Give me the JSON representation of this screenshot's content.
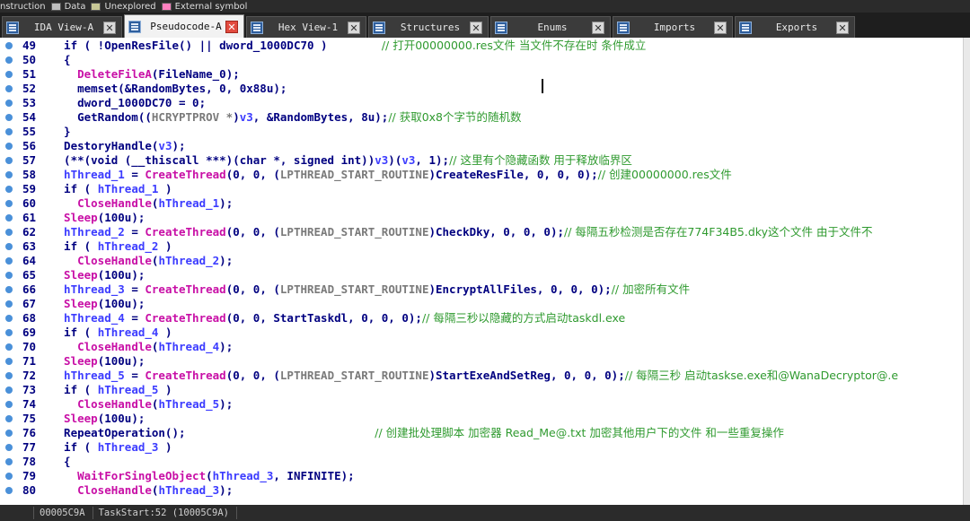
{
  "legend": [
    {
      "label": "nstruction",
      "color": ""
    },
    {
      "label": "Data",
      "color": "#c0c0c0"
    },
    {
      "label": "Unexplored",
      "color": "#c8c896"
    },
    {
      "label": "External symbol",
      "color": "#ff80c0"
    }
  ],
  "tabs": [
    {
      "label": "IDA View-A",
      "active": false,
      "icon": "ida-view-icon"
    },
    {
      "label": "Pseudocode-A",
      "active": true,
      "icon": "pseudocode-icon"
    },
    {
      "label": "Hex View-1",
      "active": false,
      "icon": "hex-view-icon"
    },
    {
      "label": "Structures",
      "active": false,
      "icon": "structures-icon"
    },
    {
      "label": "Enums",
      "active": false,
      "icon": "enums-icon"
    },
    {
      "label": "Imports",
      "active": false,
      "icon": "imports-icon"
    },
    {
      "label": "Exports",
      "active": false,
      "icon": "exports-icon"
    }
  ],
  "code_lines": [
    {
      "num": "49",
      "parts": [
        [
          "k",
          "  if ( !"
        ],
        [
          "fn2",
          "OpenResFile"
        ],
        [
          "k",
          "() || dword_1000DC70 )"
        ],
        [
          "sp",
          "        "
        ],
        [
          "cm",
          "// 打开00000000.res文件 当文件不存在时 条件成立"
        ]
      ]
    },
    {
      "num": "50",
      "parts": [
        [
          "k",
          "  {"
        ]
      ]
    },
    {
      "num": "51",
      "parts": [
        [
          "k",
          "    "
        ],
        [
          "fn",
          "DeleteFileA"
        ],
        [
          "k",
          "(FileName_0);"
        ]
      ]
    },
    {
      "num": "52",
      "parts": [
        [
          "k",
          "    memset(&RandomBytes, 0, 0x88u);"
        ]
      ]
    },
    {
      "num": "53",
      "parts": [
        [
          "k",
          "    dword_1000DC70 = 0;"
        ]
      ]
    },
    {
      "num": "54",
      "parts": [
        [
          "k",
          "    GetRandom(("
        ],
        [
          "cast",
          "HCRYPTPROV *"
        ],
        [
          "k",
          ")"
        ],
        [
          "lv",
          "v3"
        ],
        [
          "k",
          ", &RandomBytes, 8u);"
        ],
        [
          "cm",
          "// 获取0x8个字节的随机数"
        ]
      ]
    },
    {
      "num": "55",
      "parts": [
        [
          "k",
          "  }"
        ]
      ]
    },
    {
      "num": "56",
      "parts": [
        [
          "k",
          "  DestoryHandle("
        ],
        [
          "lv",
          "v3"
        ],
        [
          "k",
          ");"
        ]
      ]
    },
    {
      "num": "57",
      "parts": [
        [
          "k",
          "  (**(void (__thiscall ***)(char *, signed int))"
        ],
        [
          "lv",
          "v3"
        ],
        [
          "k",
          ")("
        ],
        [
          "lv",
          "v3"
        ],
        [
          "k",
          ", 1);"
        ],
        [
          "cm",
          "// 这里有个隐藏函数 用于释放临界区"
        ]
      ]
    },
    {
      "num": "58",
      "parts": [
        [
          "lv",
          "  hThread_1"
        ],
        [
          "k",
          " = "
        ],
        [
          "fn",
          "CreateThread"
        ],
        [
          "k",
          "(0, 0, ("
        ],
        [
          "cast",
          "LPTHREAD_START_ROUTINE"
        ],
        [
          "k",
          ")CreateResFile, 0, 0, 0);"
        ],
        [
          "cm",
          "// 创建00000000.res文件"
        ]
      ]
    },
    {
      "num": "59",
      "parts": [
        [
          "k",
          "  if ( "
        ],
        [
          "lv",
          "hThread_1"
        ],
        [
          "k",
          " )"
        ]
      ]
    },
    {
      "num": "60",
      "parts": [
        [
          "k",
          "    "
        ],
        [
          "fn",
          "CloseHandle"
        ],
        [
          "k",
          "("
        ],
        [
          "lv",
          "hThread_1"
        ],
        [
          "k",
          ");"
        ]
      ]
    },
    {
      "num": "61",
      "parts": [
        [
          "fn",
          "  Sleep"
        ],
        [
          "k",
          "(100u);"
        ]
      ]
    },
    {
      "num": "62",
      "parts": [
        [
          "lv",
          "  hThread_2"
        ],
        [
          "k",
          " = "
        ],
        [
          "fn",
          "CreateThread"
        ],
        [
          "k",
          "(0, 0, ("
        ],
        [
          "cast",
          "LPTHREAD_START_ROUTINE"
        ],
        [
          "k",
          ")CheckDky, 0, 0, 0);"
        ],
        [
          "cm",
          "// 每隔五秒检测是否存在774F34B5.dky这个文件 由于文件不"
        ]
      ]
    },
    {
      "num": "63",
      "parts": [
        [
          "k",
          "  if ( "
        ],
        [
          "lv",
          "hThread_2"
        ],
        [
          "k",
          " )"
        ]
      ]
    },
    {
      "num": "64",
      "parts": [
        [
          "k",
          "    "
        ],
        [
          "fn",
          "CloseHandle"
        ],
        [
          "k",
          "("
        ],
        [
          "lv",
          "hThread_2"
        ],
        [
          "k",
          ");"
        ]
      ]
    },
    {
      "num": "65",
      "parts": [
        [
          "fn",
          "  Sleep"
        ],
        [
          "k",
          "(100u);"
        ]
      ]
    },
    {
      "num": "66",
      "parts": [
        [
          "lv",
          "  hThread_3"
        ],
        [
          "k",
          " = "
        ],
        [
          "fn",
          "CreateThread"
        ],
        [
          "k",
          "(0, 0, ("
        ],
        [
          "cast",
          "LPTHREAD_START_ROUTINE"
        ],
        [
          "k",
          ")EncryptAllFiles, 0, 0, 0);"
        ],
        [
          "cm",
          "// 加密所有文件"
        ]
      ]
    },
    {
      "num": "67",
      "parts": [
        [
          "fn",
          "  Sleep"
        ],
        [
          "k",
          "(100u);"
        ]
      ]
    },
    {
      "num": "68",
      "parts": [
        [
          "lv",
          "  hThread_4"
        ],
        [
          "k",
          " = "
        ],
        [
          "fn",
          "CreateThread"
        ],
        [
          "k",
          "(0, 0, StartTaskdl, 0, 0, 0);"
        ],
        [
          "cm",
          "// 每隔三秒以隐藏的方式启动taskdl.exe"
        ]
      ]
    },
    {
      "num": "69",
      "parts": [
        [
          "k",
          "  if ( "
        ],
        [
          "lv",
          "hThread_4"
        ],
        [
          "k",
          " )"
        ]
      ]
    },
    {
      "num": "70",
      "parts": [
        [
          "k",
          "    "
        ],
        [
          "fn",
          "CloseHandle"
        ],
        [
          "k",
          "("
        ],
        [
          "lv",
          "hThread_4"
        ],
        [
          "k",
          ");"
        ]
      ]
    },
    {
      "num": "71",
      "parts": [
        [
          "fn",
          "  Sleep"
        ],
        [
          "k",
          "(100u);"
        ]
      ]
    },
    {
      "num": "72",
      "parts": [
        [
          "lv",
          "  hThread_5"
        ],
        [
          "k",
          " = "
        ],
        [
          "fn",
          "CreateThread"
        ],
        [
          "k",
          "(0, 0, ("
        ],
        [
          "cast",
          "LPTHREAD_START_ROUTINE"
        ],
        [
          "k",
          ")StartExeAndSetReg, 0, 0, 0);"
        ],
        [
          "cm",
          "// 每隔三秒 启动taskse.exe和@WanaDecryptor@.e"
        ]
      ]
    },
    {
      "num": "73",
      "parts": [
        [
          "k",
          "  if ( "
        ],
        [
          "lv",
          "hThread_5"
        ],
        [
          "k",
          " )"
        ]
      ]
    },
    {
      "num": "74",
      "parts": [
        [
          "k",
          "    "
        ],
        [
          "fn",
          "CloseHandle"
        ],
        [
          "k",
          "("
        ],
        [
          "lv",
          "hThread_5"
        ],
        [
          "k",
          ");"
        ]
      ]
    },
    {
      "num": "75",
      "parts": [
        [
          "fn",
          "  Sleep"
        ],
        [
          "k",
          "(100u);"
        ]
      ]
    },
    {
      "num": "76",
      "parts": [
        [
          "k",
          "  RepeatOperation();"
        ],
        [
          "sp",
          "                            "
        ],
        [
          "cm",
          "// 创建批处理脚本 加密器 Read_Me@.txt 加密其他用户下的文件 和一些重复操作"
        ]
      ]
    },
    {
      "num": "77",
      "parts": [
        [
          "k",
          "  if ( "
        ],
        [
          "lv",
          "hThread_3"
        ],
        [
          "k",
          " )"
        ]
      ]
    },
    {
      "num": "78",
      "parts": [
        [
          "k",
          "  {"
        ]
      ]
    },
    {
      "num": "79",
      "parts": [
        [
          "k",
          "    "
        ],
        [
          "fn",
          "WaitForSingleObject"
        ],
        [
          "k",
          "("
        ],
        [
          "lv",
          "hThread_3"
        ],
        [
          "k",
          ", INFINITE);"
        ]
      ]
    },
    {
      "num": "80",
      "parts": [
        [
          "k",
          "    "
        ],
        [
          "fn",
          "CloseHandle"
        ],
        [
          "k",
          "("
        ],
        [
          "lv",
          "hThread_3"
        ],
        [
          "k",
          ");"
        ]
      ]
    }
  ],
  "status": {
    "address": "00005C9A",
    "location": "TaskStart:52 (10005C9A)"
  },
  "colors": {
    "keyword": "#000080",
    "function": "#c80fa6",
    "local_var": "#3c3cff",
    "comment": "#2f9a2f",
    "breakpoint": "#4a90d9"
  }
}
